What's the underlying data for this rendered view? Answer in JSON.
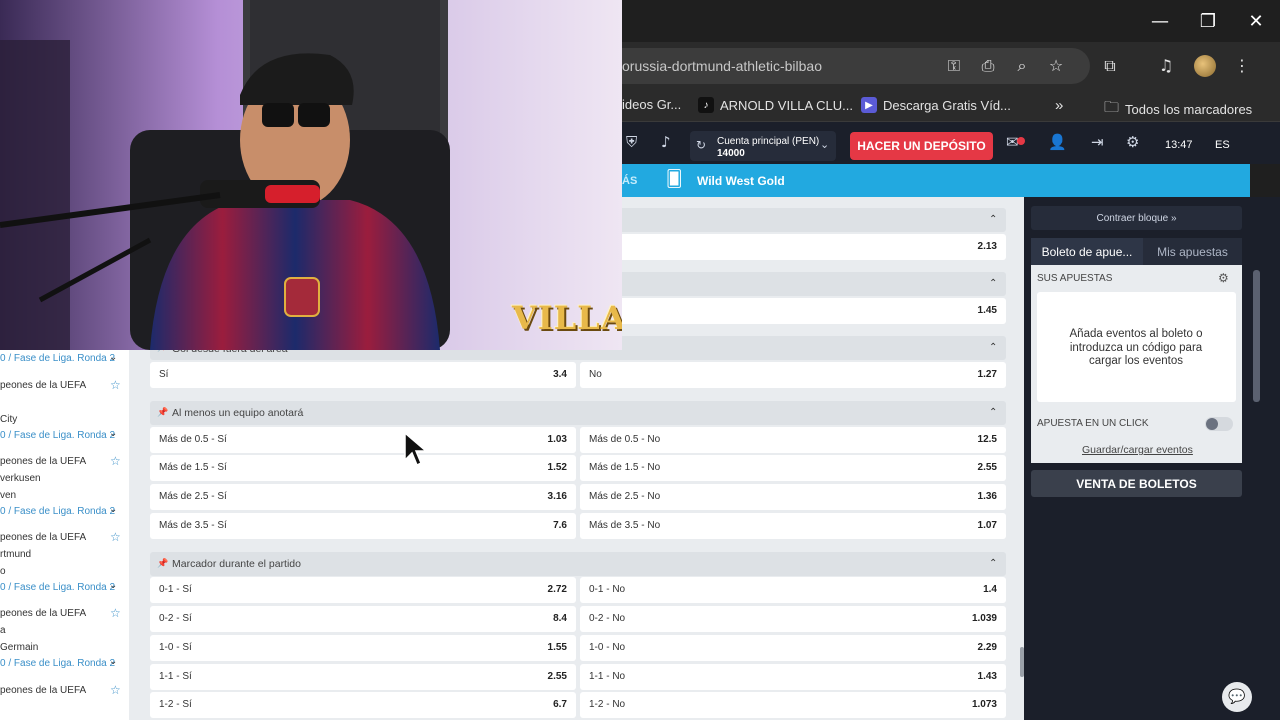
{
  "browser": {
    "url": "orussia-dortmund-athletic-bilbao",
    "bookmarks": [
      {
        "label": "ideos Gr..."
      },
      {
        "label": "ARNOLD VILLA CLU..."
      },
      {
        "label": "Descarga Gratis Víd..."
      }
    ],
    "more_bookmarks": "»",
    "all_bookmarks": "Todos los marcadores"
  },
  "header": {
    "account_label": "Cuenta principal  (PEN)",
    "account_balance": "14000",
    "deposit_label": "HACER UN DEPÓSITO",
    "time": "13:47",
    "language": "ES"
  },
  "nav": {
    "more": "ÁS",
    "game": "Wild West Gold"
  },
  "left_panel": {
    "items": [
      {
        "text": "0 / Fase de Liga. Ronda 2",
        "kind": "link"
      },
      {
        "text": "peones de la UEFA",
        "kind": "league"
      },
      {
        "text": "City",
        "kind": "team"
      },
      {
        "text": "0 / Fase de Liga. Ronda 2",
        "kind": "link"
      },
      {
        "text": "peones de la UEFA",
        "kind": "league"
      },
      {
        "text": "verkusen",
        "kind": "team"
      },
      {
        "text": "ven",
        "kind": "team"
      },
      {
        "text": "0 / Fase de Liga. Ronda 2",
        "kind": "link"
      },
      {
        "text": "peones de la UEFA",
        "kind": "league"
      },
      {
        "text": "rtmund",
        "kind": "team"
      },
      {
        "text": "o",
        "kind": "team"
      },
      {
        "text": "0 / Fase de Liga. Ronda 2",
        "kind": "link"
      },
      {
        "text": "peones de la UEFA",
        "kind": "league"
      },
      {
        "text": "a",
        "kind": "team"
      },
      {
        "text": "Germain",
        "kind": "team"
      },
      {
        "text": "0 / Fase de Liga. Ronda 2",
        "kind": "link"
      },
      {
        "text": "peones de la UEFA",
        "kind": "league"
      }
    ]
  },
  "markets": {
    "top_odd_1": "2.13",
    "top_odd_2": "1.45",
    "gol_title": "Gol desde fuera del área",
    "gol": [
      {
        "label": "Sí",
        "odd": "3.4"
      },
      {
        "label": "No",
        "odd": "1.27"
      }
    ],
    "al_menos_title": "Al menos un equipo anotará",
    "al_menos": [
      {
        "label": "Más de 0.5 - Sí",
        "odd": "1.03"
      },
      {
        "label": "Más de 0.5 - No",
        "odd": "12.5"
      },
      {
        "label": "Más de 1.5 - Sí",
        "odd": "1.52"
      },
      {
        "label": "Más de 1.5 - No",
        "odd": "2.55"
      },
      {
        "label": "Más de 2.5 - Sí",
        "odd": "3.16"
      },
      {
        "label": "Más de 2.5 - No",
        "odd": "1.36"
      },
      {
        "label": "Más de 3.5 - Sí",
        "odd": "7.6"
      },
      {
        "label": "Más de 3.5 - No",
        "odd": "1.07"
      }
    ],
    "marcador_title": "Marcador durante el partido",
    "marcador": [
      {
        "label": "0-1 - Sí",
        "odd": "2.72"
      },
      {
        "label": "0-1 - No",
        "odd": "1.4"
      },
      {
        "label": "0-2 - Sí",
        "odd": "8.4"
      },
      {
        "label": "0-2 - No",
        "odd": "1.039"
      },
      {
        "label": "1-0 - Sí",
        "odd": "1.55"
      },
      {
        "label": "1-0 - No",
        "odd": "2.29"
      },
      {
        "label": "1-1 - Sí",
        "odd": "2.55"
      },
      {
        "label": "1-1 - No",
        "odd": "1.43"
      },
      {
        "label": "1-2 - Sí",
        "odd": "6.7"
      },
      {
        "label": "1-2 - No",
        "odd": "1.073"
      }
    ]
  },
  "betslip": {
    "collapse": "Contraer bloque »",
    "tab_slip": "Boleto de apue...",
    "tab_mybets": "Mis apuestas",
    "title": "SUS APUESTAS",
    "empty_msg": "Añada eventos al boleto o introduzca un código para cargar los eventos",
    "one_click": "APUESTA EN UN CLICK",
    "save_load": "Guardar/cargar eventos",
    "sell": "VENTA DE BOLETOS"
  },
  "webcam": {
    "logo": "VILLA"
  },
  "colors": {
    "accent": "#22a9e0",
    "deposit": "#e53845",
    "header": "#1b1f2a"
  }
}
